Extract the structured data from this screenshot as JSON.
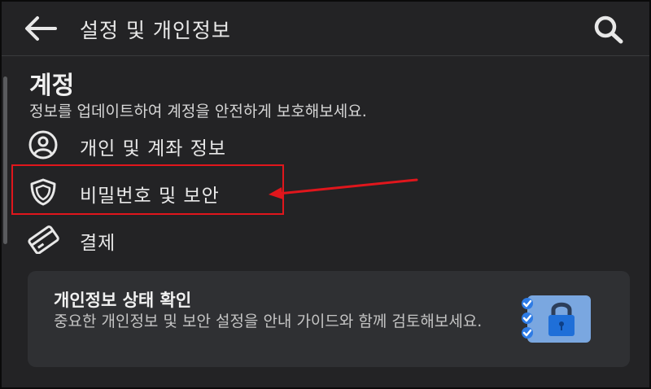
{
  "header": {
    "title": "설정 및 개인정보",
    "back_icon": "back-arrow-icon",
    "search_icon": "search-icon"
  },
  "section": {
    "title": "계정",
    "description": "정보를 업데이트하여 계정을 안전하게 보호해보세요."
  },
  "menu": {
    "items": [
      {
        "label": "개인 및 계좌 정보",
        "icon": "person-circle-icon"
      },
      {
        "label": "비밀번호 및 보안",
        "icon": "shield-icon",
        "highlighted": true
      },
      {
        "label": "결제",
        "icon": "payment-card-icon"
      }
    ]
  },
  "card": {
    "title": "개인정보 상태 확인",
    "description": "중요한 개인정보 및 보안 설정을 안내 가이드와 함께 검토해보세요.",
    "illustration": "checklist-lock-icon"
  },
  "colors": {
    "background": "#232325",
    "card": "#2f3033",
    "highlight": "#e0161c",
    "accent_blue": "#3b8ef0"
  }
}
